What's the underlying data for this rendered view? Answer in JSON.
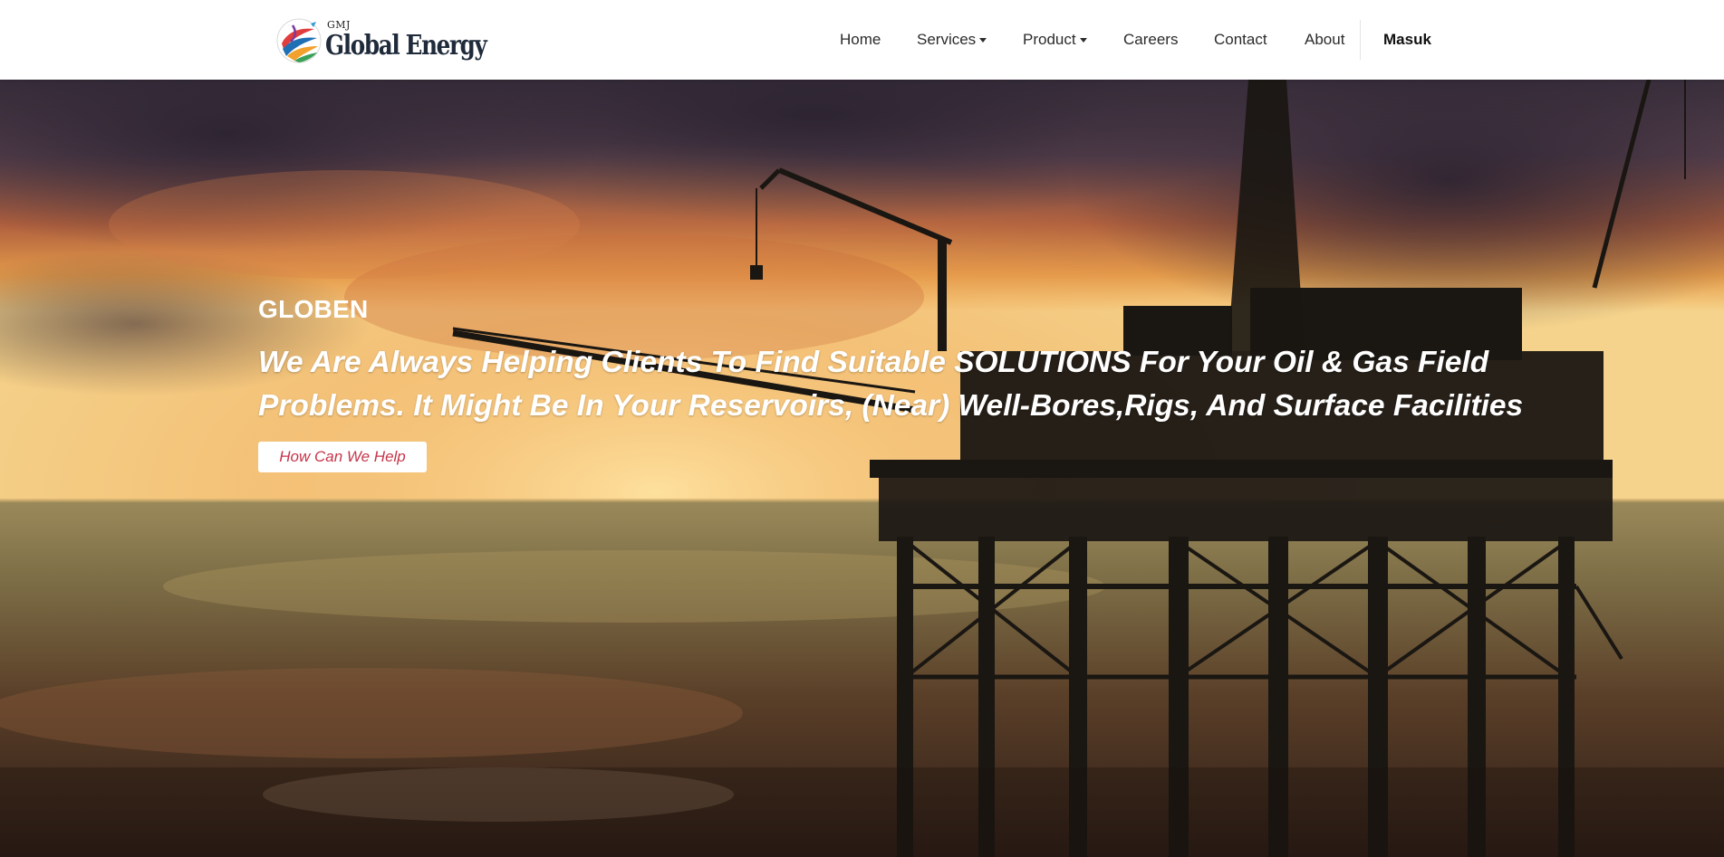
{
  "header": {
    "logo": {
      "small_text": "GMJ",
      "brand_text": "Global Energy"
    },
    "nav": [
      {
        "label": "Home",
        "has_dropdown": false
      },
      {
        "label": "Services",
        "has_dropdown": true
      },
      {
        "label": "Product",
        "has_dropdown": true
      },
      {
        "label": "Careers",
        "has_dropdown": false
      },
      {
        "label": "Contact",
        "has_dropdown": false
      },
      {
        "label": "About",
        "has_dropdown": false
      }
    ],
    "user_name": "Masuk"
  },
  "hero": {
    "background": "offshore-oil-rig-sunset-photo",
    "brand": "GLOBEN",
    "tagline": "We Are Always Helping Clients To Find Suitable SOLUTIONS For Your Oil & Gas Field Problems. It Might Be In Your Reservoirs, (Near) Well-Bores,Rigs, And Surface Facilities",
    "cta_label": "How Can We Help"
  },
  "colors": {
    "navbar_bg": "#ffffff",
    "nav_text": "#2b2b2b",
    "cta_text": "#c7354a",
    "hero_text": "#ffffff"
  }
}
